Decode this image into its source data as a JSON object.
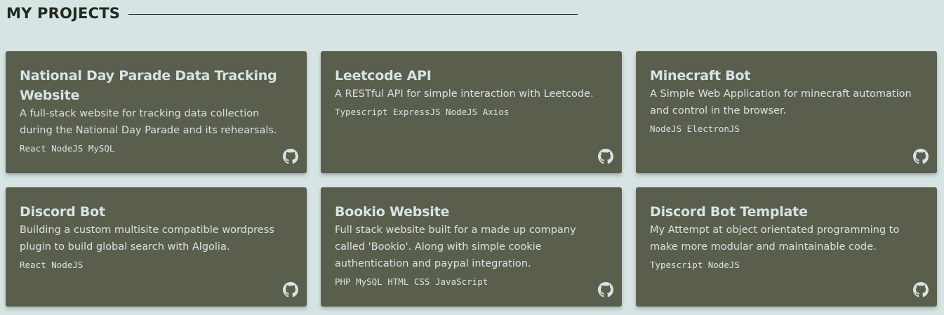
{
  "section": {
    "title": "MY PROJECTS"
  },
  "projects": [
    {
      "title": "National Day Parade Data Tracking Website",
      "description": "A full-stack website for tracking data collection during the National Day Parade and its rehearsals.",
      "tech": "React NodeJS MySQL",
      "icon": "github-icon"
    },
    {
      "title": "Leetcode API",
      "description": "A RESTful API for simple interaction with Leetcode.",
      "tech": "Typescript ExpressJS NodeJS Axios",
      "icon": "github-icon"
    },
    {
      "title": "Minecraft Bot",
      "description": "A Simple Web Application for minecraft automation and control in the browser.",
      "tech": "NodeJS ElectronJS",
      "icon": "github-icon"
    },
    {
      "title": "Discord Bot",
      "description": "Building a custom multisite compatible wordpress plugin to build global search with Algolia.",
      "tech": "React NodeJS",
      "icon": "github-icon"
    },
    {
      "title": "Bookio Website",
      "description": "Full stack website built for a made up company called 'Bookio'. Along with simple cookie authentication and paypal integration.",
      "tech": "PHP MySQL HTML CSS JavaScript",
      "icon": "github-icon"
    },
    {
      "title": "Discord Bot Template",
      "description": "My Attempt at object orientated programming to make more modular and maintainable code.",
      "tech": "Typescript NodeJS",
      "icon": "github-icon"
    }
  ],
  "colors": {
    "background": "#d6e4e3",
    "card": "#5a5e4d",
    "card_text": "#d6e4e3",
    "heading": "#22291f"
  }
}
